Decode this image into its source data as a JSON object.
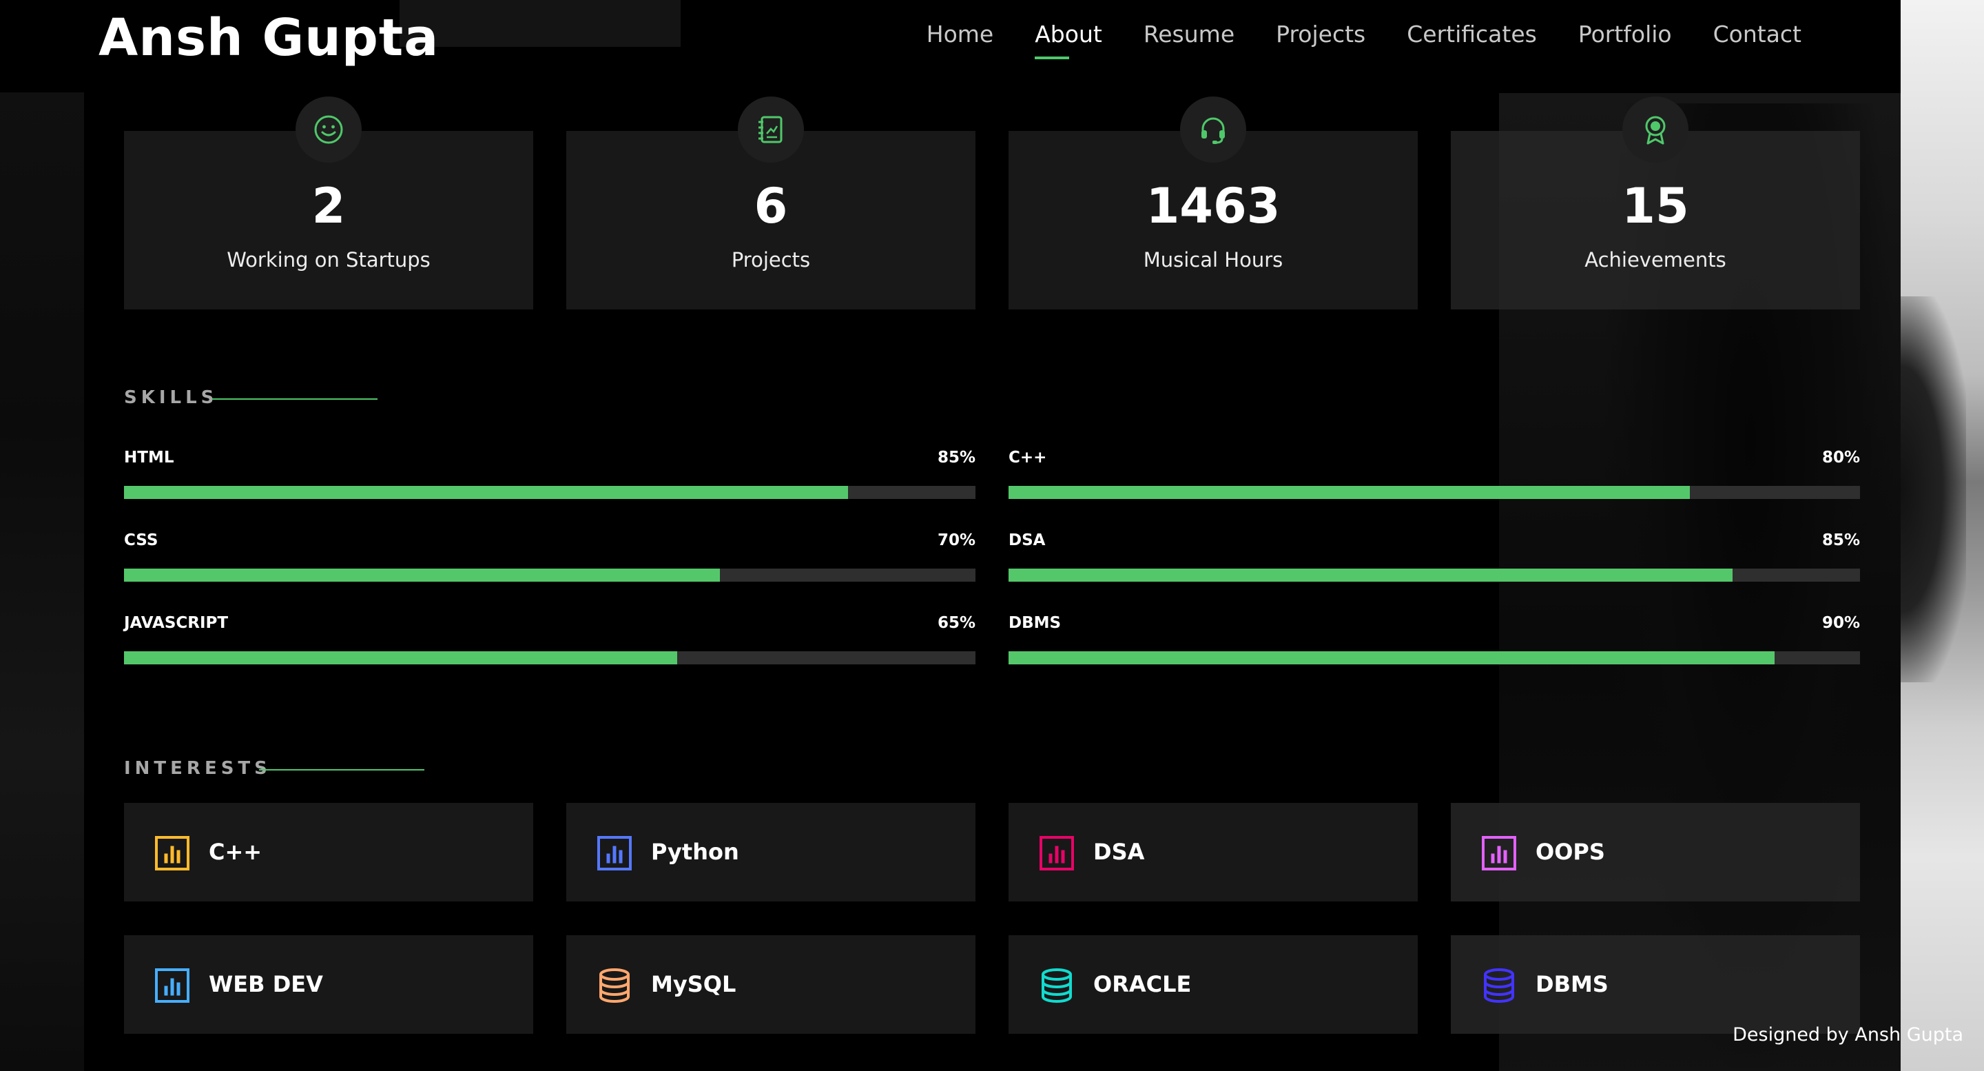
{
  "header": {
    "logo": "Ansh Gupta",
    "nav": [
      "Home",
      "About",
      "Resume",
      "Projects",
      "Certificates",
      "Portfolio",
      "Contact"
    ],
    "active": "About"
  },
  "counts": [
    {
      "number": "2",
      "label": "Working on Startups",
      "icon": "smiley-icon"
    },
    {
      "number": "6",
      "label": "Projects",
      "icon": "journal-icon"
    },
    {
      "number": "1463",
      "label": "Musical Hours",
      "icon": "headset-icon"
    },
    {
      "number": "15",
      "label": "Achievements",
      "icon": "award-icon"
    }
  ],
  "skills": {
    "title": "SKILLS",
    "items": [
      {
        "name": "HTML",
        "percent": "85%",
        "value": 85
      },
      {
        "name": "C++",
        "percent": "80%",
        "value": 80
      },
      {
        "name": "CSS",
        "percent": "70%",
        "value": 70
      },
      {
        "name": "DSA",
        "percent": "85%",
        "value": 85
      },
      {
        "name": "JAVASCRIPT",
        "percent": "65%",
        "value": 65
      },
      {
        "name": "DBMS",
        "percent": "90%",
        "value": 90
      }
    ]
  },
  "interests": {
    "title": "INTERESTS",
    "items": [
      {
        "label": "C++",
        "icon": "bar-chart-icon",
        "color": "#ffbb2c"
      },
      {
        "label": "Python",
        "icon": "bar-chart-icon",
        "color": "#5578ff"
      },
      {
        "label": "DSA",
        "icon": "bar-chart-icon",
        "color": "#e80368"
      },
      {
        "label": "OOPS",
        "icon": "bar-chart-icon",
        "color": "#e361ff"
      },
      {
        "label": "WEB DEV",
        "icon": "bar-chart-icon",
        "color": "#47aeff"
      },
      {
        "label": "MySQL",
        "icon": "database-icon",
        "color": "#ffa76e"
      },
      {
        "label": "ORACLE",
        "icon": "database-icon",
        "color": "#11dbcf"
      },
      {
        "label": "DBMS",
        "icon": "database-icon",
        "color": "#4233ff"
      }
    ]
  },
  "accent": "#4fc86a",
  "footer": {
    "credits": "Designed by Ansh Gupta"
  }
}
